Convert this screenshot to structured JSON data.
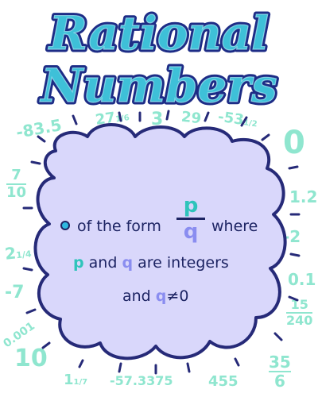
{
  "title": {
    "line1": "Rational",
    "line2": "Numbers"
  },
  "definition": {
    "line1_prefix": "of the form",
    "fraction_numerator": "p",
    "fraction_denominator": "q",
    "line1_suffix": "where",
    "line2_p": "p",
    "line2_and": "and",
    "line2_q": "q",
    "line2_suffix": "are integers",
    "line3_and": "and",
    "line3_q": "q",
    "line3_neq": "≠0"
  },
  "examples": {
    "top_1": "-83.5",
    "top_2_whole": "27",
    "top_2_frac": "1/6",
    "top_3": "3",
    "top_4": "29",
    "top_5": "-53",
    "top_5_frac": "1/2",
    "left_frac_num": "7",
    "left_frac_den": "10",
    "left_mixed_whole": "2",
    "left_mixed_frac": "1/4",
    "left_7": "-7",
    "left_dec": "0.001",
    "left_10": "10",
    "right_0": "0",
    "right_12": "1.2",
    "right_2": "-2",
    "right_01": "0.1",
    "right_frac_num": "15",
    "right_frac_den": "240",
    "bottom_1_whole": "1",
    "bottom_1_frac": "1/7",
    "bottom_2": "-57.3375",
    "bottom_3": "455",
    "bottom_frac_num": "35",
    "bottom_frac_den": "6"
  },
  "colors": {
    "title_fill": "#3ec0d8",
    "title_outline": "#1d2c86",
    "cloud_fill": "#d9d7fb",
    "cloud_outline": "#262a78",
    "example_numbers": "#8fe6cf",
    "p_color": "#2fc4bb",
    "q_color": "#8a8df0"
  }
}
